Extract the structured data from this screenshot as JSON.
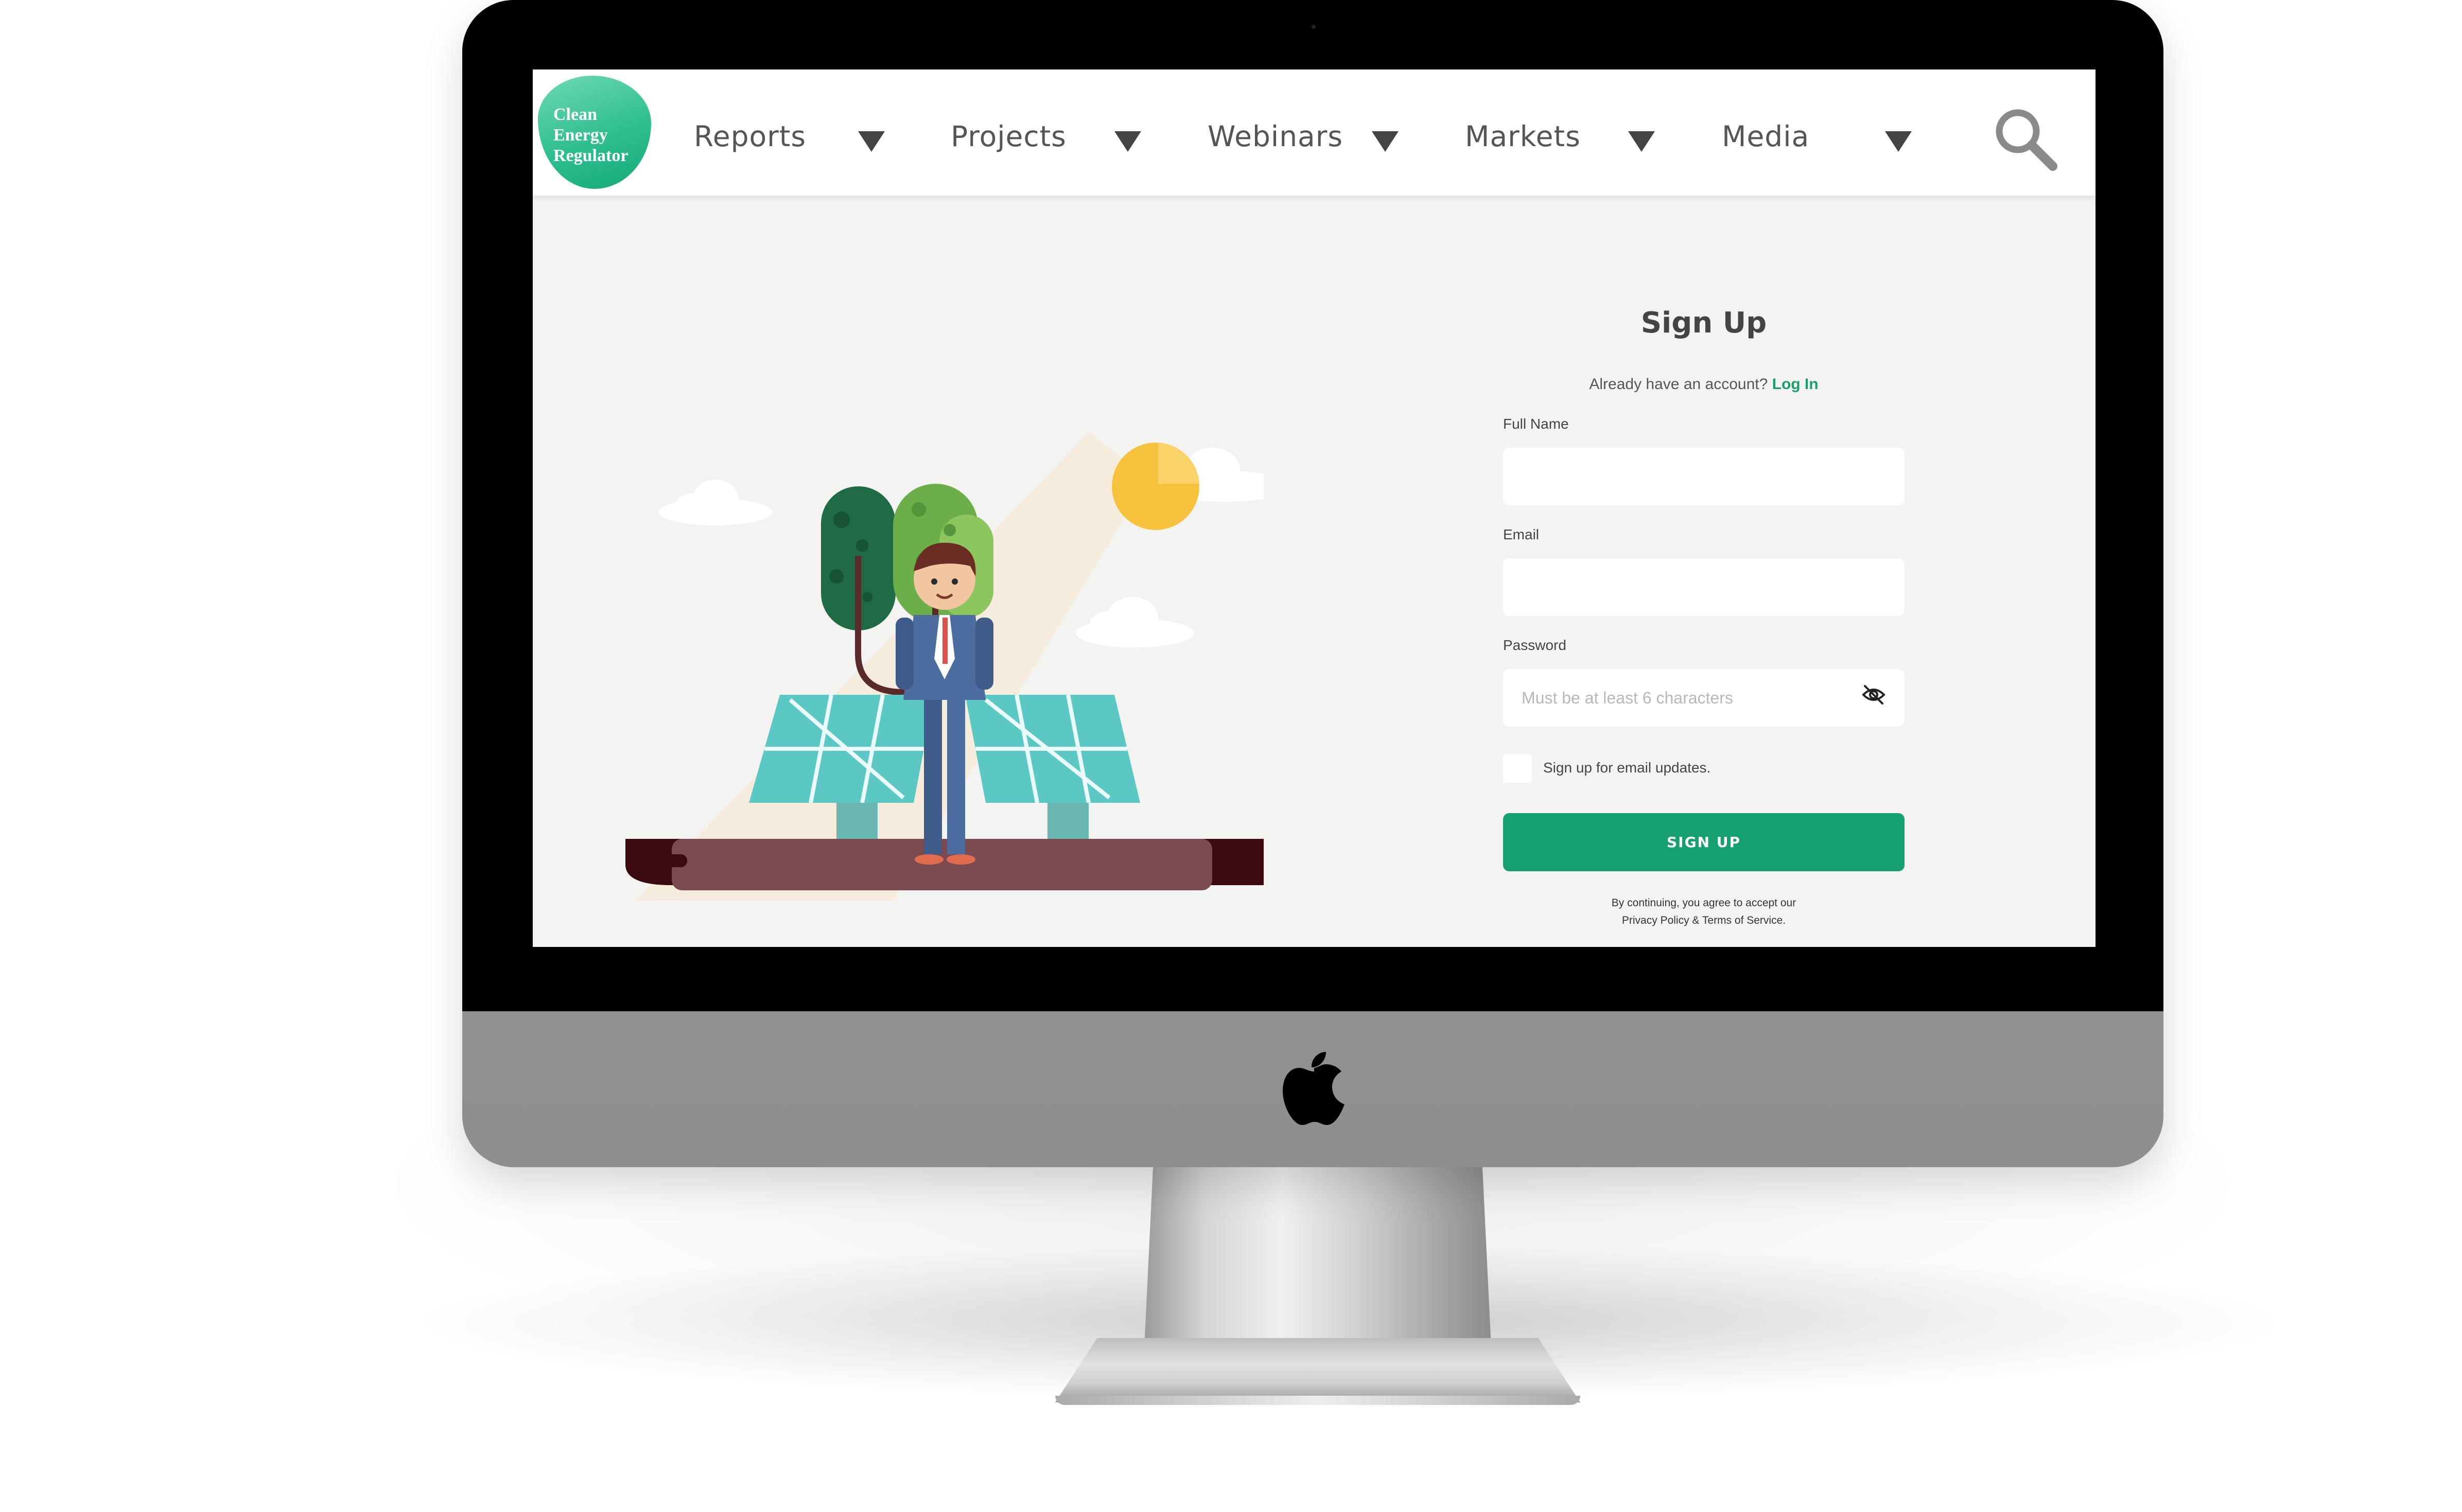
{
  "brand": {
    "logo_text": "Clean\nEnergy\nRegulator",
    "accent_color": "#17a06f"
  },
  "nav": {
    "items": [
      {
        "label": "Reports",
        "icon": "caret-down-icon"
      },
      {
        "label": "Projects",
        "icon": "caret-down-icon"
      },
      {
        "label": "Webinars",
        "icon": "caret-down-icon"
      },
      {
        "label": "Markets",
        "icon": "caret-down-icon"
      },
      {
        "label": "Media",
        "icon": "caret-down-icon"
      }
    ],
    "search_icon": "search-icon"
  },
  "signup": {
    "title": "Sign Up",
    "have_account": "Already have an account?",
    "login_link": "Log In",
    "full_name_label": "Full Name",
    "full_name_value": "",
    "email_label": "Email",
    "email_value": "",
    "password_label": "Password",
    "password_placeholder": "Must be at least 6 characters",
    "password_toggle_icon": "eye-off-icon",
    "updates_label": "Sign up for email updates.",
    "updates_checked": false,
    "button_label": "SIGN UP",
    "legal_line1": "By continuing, you agree to accept our",
    "legal_line2": "Privacy Policy & Terms of Service."
  },
  "device": {
    "chin_logo_icon": "apple-logo-icon"
  }
}
